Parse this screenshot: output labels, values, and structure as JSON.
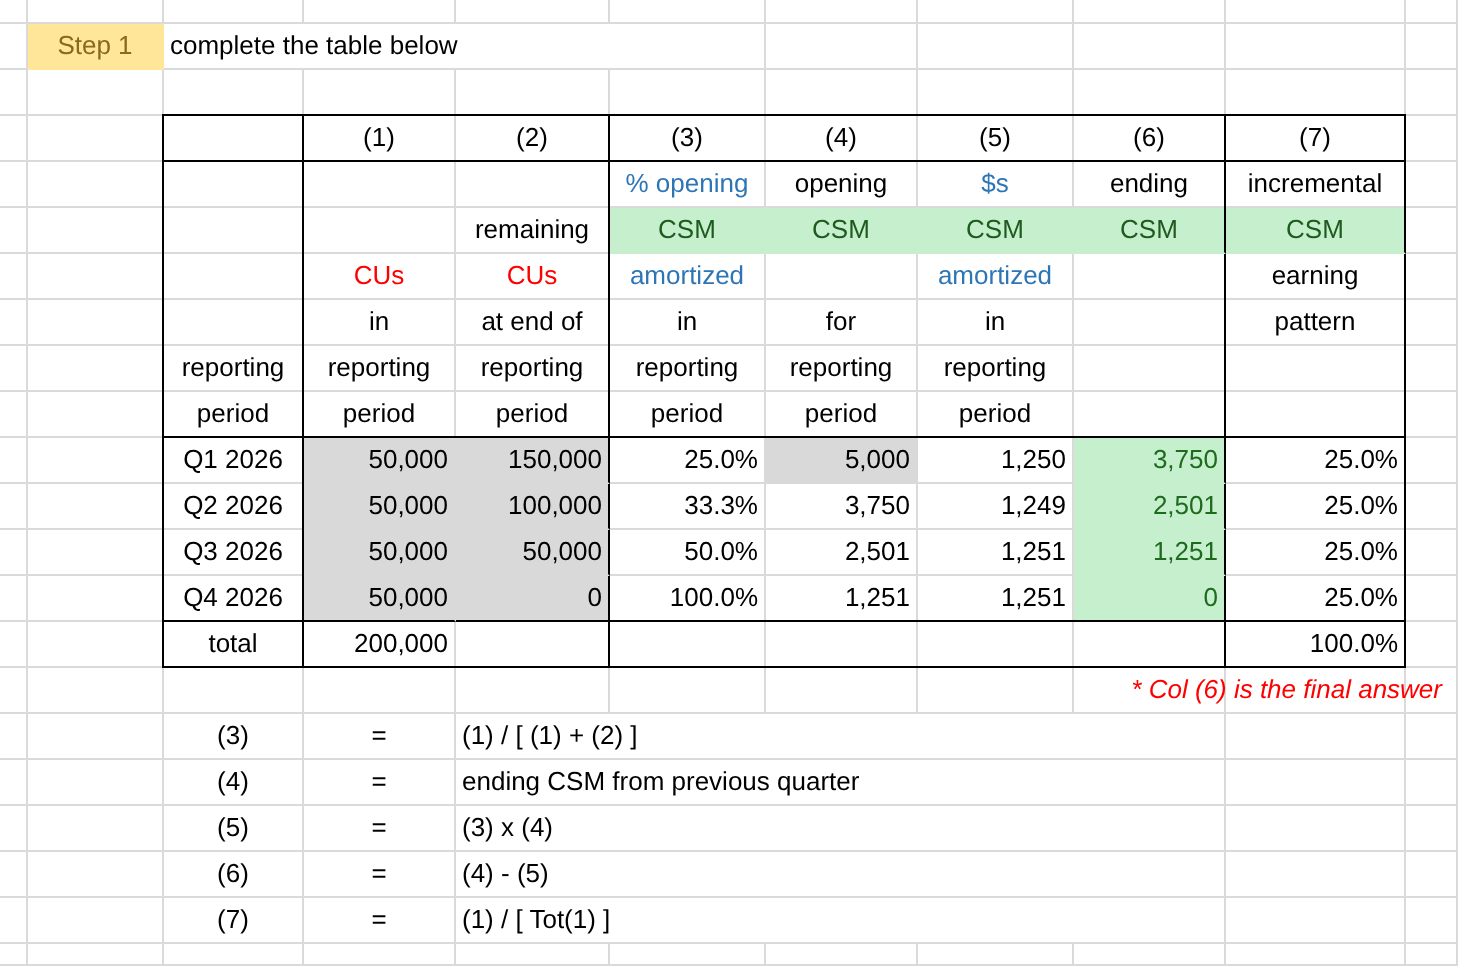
{
  "step": {
    "label": "Step 1",
    "text": "complete the table below"
  },
  "table": {
    "columns": [
      {
        "heading_bottom": [
          {
            "text": "reporting",
            "kind": "plain"
          },
          {
            "text": "period",
            "kind": "plain"
          }
        ]
      },
      {
        "number": "(1)",
        "heading_bottom": [
          {
            "text": "CUs",
            "kind": "units"
          },
          {
            "text": "in",
            "kind": "plain"
          },
          {
            "text": "reporting",
            "kind": "plain"
          },
          {
            "text": "period",
            "kind": "plain"
          }
        ]
      },
      {
        "number": "(2)",
        "heading_bottom": [
          {
            "text": "remaining",
            "kind": "plain"
          },
          {
            "text": "CUs",
            "kind": "units"
          },
          {
            "text": "at end of",
            "kind": "plain"
          },
          {
            "text": "reporting",
            "kind": "plain"
          },
          {
            "text": "period",
            "kind": "plain"
          }
        ]
      },
      {
        "number": "(3)",
        "heading_top": [
          {
            "text": "% opening",
            "kind": "measure"
          },
          {
            "text": "CSM",
            "kind": "csm"
          },
          {
            "text": "amortized",
            "kind": "measure"
          },
          {
            "text": "in",
            "kind": "plain"
          },
          {
            "text": "reporting",
            "kind": "plain"
          },
          {
            "text": "period",
            "kind": "plain"
          }
        ]
      },
      {
        "number": "(4)",
        "heading_top": [
          {
            "text": "opening",
            "kind": "plain"
          },
          {
            "text": "CSM",
            "kind": "csm"
          }
        ],
        "heading_bottom": [
          {
            "text": "for",
            "kind": "plain"
          },
          {
            "text": "reporting",
            "kind": "plain"
          },
          {
            "text": "period",
            "kind": "plain"
          }
        ]
      },
      {
        "number": "(5)",
        "heading_top": [
          {
            "text": "$s",
            "kind": "measure"
          },
          {
            "text": "CSM",
            "kind": "csm"
          },
          {
            "text": "amortized",
            "kind": "measure"
          },
          {
            "text": "in",
            "kind": "plain"
          },
          {
            "text": "reporting",
            "kind": "plain"
          },
          {
            "text": "period",
            "kind": "plain"
          }
        ]
      },
      {
        "number": "(6)",
        "heading_top": [
          {
            "text": "ending",
            "kind": "plain"
          },
          {
            "text": "CSM",
            "kind": "csm"
          }
        ]
      },
      {
        "number": "(7)",
        "heading_top": [
          {
            "text": "incremental",
            "kind": "plain"
          },
          {
            "text": "CSM",
            "kind": "csm"
          },
          {
            "text": "earning",
            "kind": "plain"
          },
          {
            "text": "pattern",
            "kind": "plain"
          }
        ]
      }
    ],
    "rows": [
      {
        "period": "Q1 2026",
        "values": [
          {
            "text": "50,000",
            "kind": "input"
          },
          {
            "text": "150,000",
            "kind": "input"
          },
          {
            "text": "25.0%",
            "kind": "computed"
          },
          {
            "text": "5,000",
            "kind": "input"
          },
          {
            "text": "1,250",
            "kind": "computed"
          },
          {
            "text": "3,750",
            "kind": "result"
          },
          {
            "text": "25.0%",
            "kind": "computed"
          }
        ]
      },
      {
        "period": "Q2 2026",
        "values": [
          {
            "text": "50,000",
            "kind": "input"
          },
          {
            "text": "100,000",
            "kind": "input"
          },
          {
            "text": "33.3%",
            "kind": "computed"
          },
          {
            "text": "3,750",
            "kind": "computed"
          },
          {
            "text": "1,249",
            "kind": "computed"
          },
          {
            "text": "2,501",
            "kind": "result"
          },
          {
            "text": "25.0%",
            "kind": "computed"
          }
        ]
      },
      {
        "period": "Q3 2026",
        "values": [
          {
            "text": "50,000",
            "kind": "input"
          },
          {
            "text": "50,000",
            "kind": "input"
          },
          {
            "text": "50.0%",
            "kind": "computed"
          },
          {
            "text": "2,501",
            "kind": "computed"
          },
          {
            "text": "1,251",
            "kind": "computed"
          },
          {
            "text": "1,251",
            "kind": "result"
          },
          {
            "text": "25.0%",
            "kind": "computed"
          }
        ]
      },
      {
        "period": "Q4 2026",
        "values": [
          {
            "text": "50,000",
            "kind": "input"
          },
          {
            "text": "0",
            "kind": "input"
          },
          {
            "text": "100.0%",
            "kind": "computed"
          },
          {
            "text": "1,251",
            "kind": "computed"
          },
          {
            "text": "1,251",
            "kind": "computed"
          },
          {
            "text": "0",
            "kind": "result"
          },
          {
            "text": "25.0%",
            "kind": "computed"
          }
        ]
      }
    ],
    "total": {
      "label": "total",
      "column_1": "200,000",
      "column_7": "100.0%"
    }
  },
  "note": "* Col (6) is the final answer",
  "formulas": [
    {
      "column": "(3)",
      "sign": "=",
      "expression": "(1) / [ (1) + (2) ]"
    },
    {
      "column": "(4)",
      "sign": "=",
      "expression": "ending CSM from previous quarter"
    },
    {
      "column": "(5)",
      "sign": "=",
      "expression": "(3) x (4)"
    },
    {
      "column": "(6)",
      "sign": "=",
      "expression": "(4) - (5)"
    },
    {
      "column": "(7)",
      "sign": "=",
      "expression": "(1) / [ Tot(1) ]"
    }
  ]
}
